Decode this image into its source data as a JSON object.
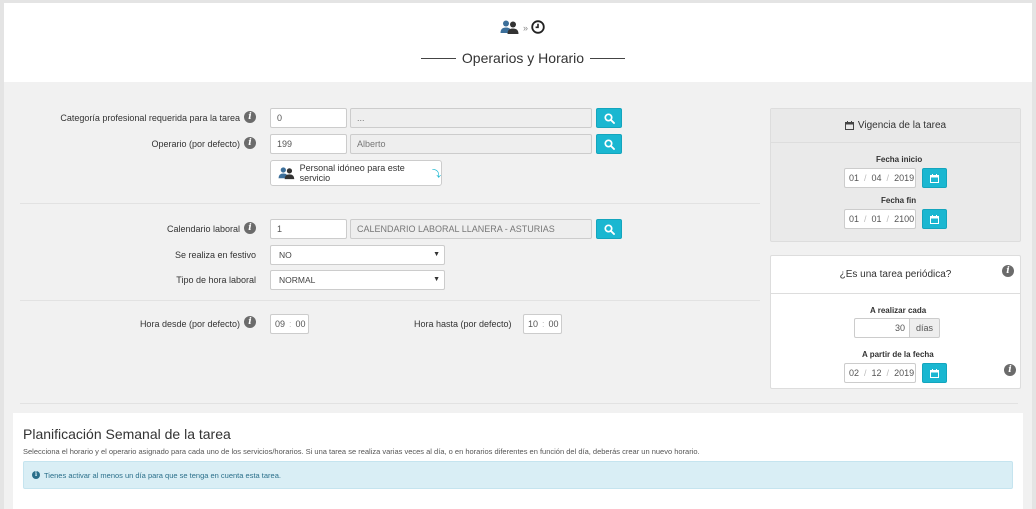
{
  "header": {
    "title": "Operarios y Horario",
    "step_separator": "»",
    "step_icons": [
      "users-icon",
      "clock-icon"
    ]
  },
  "form": {
    "categoria": {
      "label": "Categoría profesional requerida para la tarea",
      "code": "0",
      "name": "..."
    },
    "operario": {
      "label": "Operario (por defecto)",
      "code": "199",
      "name": "Alberto"
    },
    "personal_button": "Personal idóneo para este servicio",
    "calendario": {
      "label": "Calendario laboral",
      "code": "1",
      "name": "CALENDARIO LABORAL LLANERA - ASTURIAS"
    },
    "festivo": {
      "label": "Se realiza en festivo",
      "value": "NO"
    },
    "tipo_hora": {
      "label": "Tipo de hora laboral",
      "value": "NORMAL"
    },
    "hora_desde": {
      "label": "Hora desde (por defecto)",
      "hh": "09",
      "mm": "00"
    },
    "hora_hasta": {
      "label": "Hora hasta (por defecto)",
      "hh": "10",
      "mm": "00"
    }
  },
  "vigencia": {
    "title": "Vigencia de la tarea",
    "inicio": {
      "label": "Fecha inicio",
      "d": "01",
      "m": "04",
      "y": "2019"
    },
    "fin": {
      "label": "Fecha fin",
      "d": "01",
      "m": "01",
      "y": "2100"
    }
  },
  "periodica": {
    "title": "¿Es una tarea periódica?",
    "realizar": {
      "label": "A realizar cada",
      "value": "30",
      "unit": "días"
    },
    "partir": {
      "label": "A partir de la fecha",
      "d": "02",
      "m": "12",
      "y": "2019"
    }
  },
  "plan": {
    "title": "Planificación Semanal de la tarea",
    "description": "Selecciona el horario y el operario asignado para cada uno de los servicios/horarios. Si una tarea se realiza varias veces al día, o en horarios diferentes en función del día, deberás crear un nuevo horario.",
    "alert": "Tienes activar al menos un día para que se tenga en cuenta esta tarea."
  },
  "colors": {
    "accent": "#1ab7d1",
    "alert_bg": "#d9eef5"
  }
}
